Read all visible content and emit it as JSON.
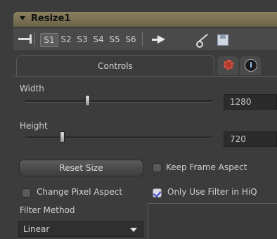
{
  "panel": {
    "title": "Resize1"
  },
  "toolbar": {
    "slots": [
      "S1",
      "S2",
      "S3",
      "S4",
      "S5",
      "S6"
    ],
    "active_slot": "S1"
  },
  "tabs": {
    "controls_label": "Controls"
  },
  "width": {
    "label": "Width",
    "value": "1280",
    "slider_level": 0.33
  },
  "height": {
    "label": "Height",
    "value": "720",
    "slider_level": 0.19
  },
  "reset_size": {
    "label": "Reset Size"
  },
  "keep_frame_aspect": {
    "label": "Keep Frame Aspect",
    "checked": false
  },
  "change_pixel_aspect": {
    "label": "Change Pixel Aspect",
    "checked": false
  },
  "only_use_filter_hiq": {
    "label": "Only Use Filter in HiQ",
    "checked": true
  },
  "filter_method": {
    "label": "Filter Method",
    "value": "Linear"
  },
  "colors": {
    "title_bar": "#7a7052",
    "background": "#3c3c3c",
    "accent_check": "#3a46c8"
  }
}
